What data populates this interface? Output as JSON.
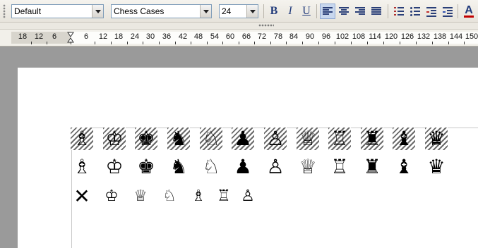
{
  "toolbar": {
    "paragraph_style": "Default",
    "font_name": "Chess Cases",
    "font_size": "24",
    "bold_label": "B",
    "italic_label": "I",
    "underline_label": "U",
    "font_color_label": "A",
    "font_color": "#c00000",
    "active_alignment": "left"
  },
  "ruler": {
    "labels": [
      "18",
      "12",
      "6",
      "6",
      "12",
      "18",
      "24",
      "30",
      "36",
      "42",
      "48",
      "54",
      "60",
      "66",
      "72",
      "78",
      "84",
      "90",
      "96",
      "102",
      "108",
      "114",
      "120",
      "126",
      "132",
      "138",
      "144",
      "150"
    ]
  },
  "document": {
    "row1_hatched": [
      "♗",
      "♔",
      "♚",
      "♞",
      "♘",
      "♟",
      "♙",
      "♕",
      "♖",
      "♜",
      "♝",
      "♛"
    ],
    "row2_plain": [
      "♗",
      "♔",
      "♚",
      "♞",
      "♘",
      "♟",
      "♙",
      "♕",
      "♖",
      "♜",
      "♝",
      "♛"
    ],
    "row3_small": [
      "✕",
      "♔",
      "♕",
      "♘",
      "♗",
      "♖",
      "♙"
    ]
  }
}
